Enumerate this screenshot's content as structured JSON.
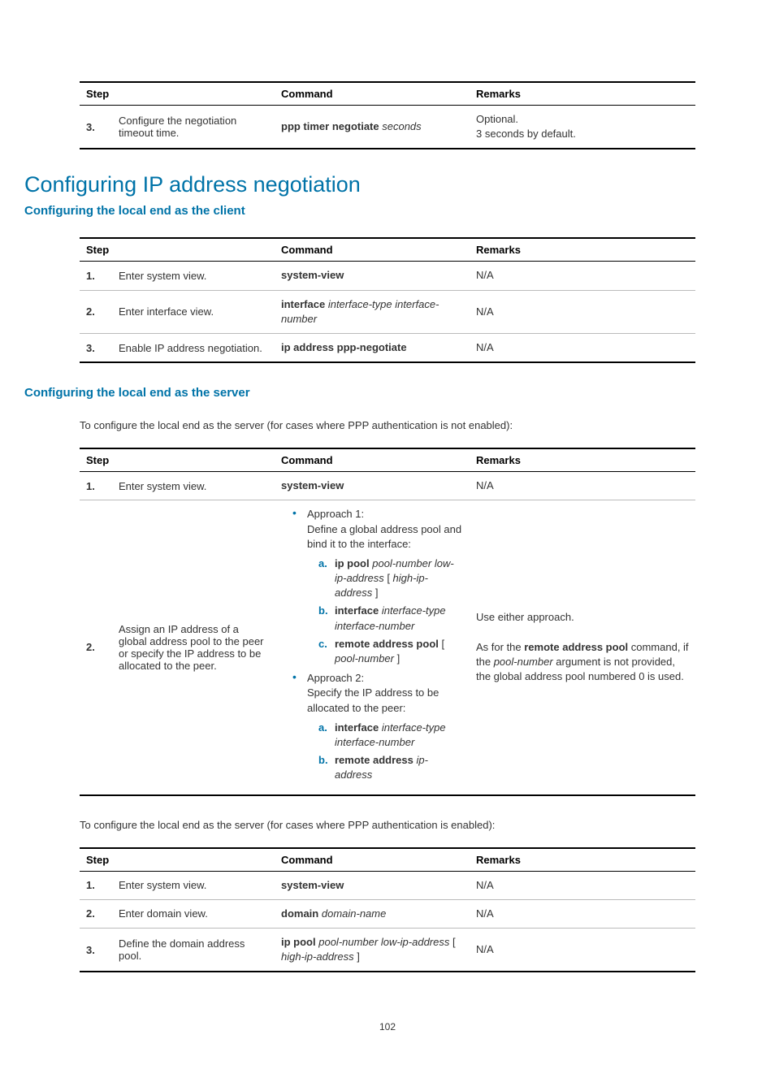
{
  "table1": {
    "headers": {
      "step": "Step",
      "command": "Command",
      "remarks": "Remarks"
    },
    "rows": [
      {
        "num": "3.",
        "step": "Configure the negotiation timeout time.",
        "cmd_bold": "ppp timer negotiate",
        "cmd_italic": " seconds",
        "remarks_line1": "Optional.",
        "remarks_line2": "3 seconds by default."
      }
    ]
  },
  "heading1": "Configuring IP address negotiation",
  "subheading1": "Configuring the local end as the client",
  "table2": {
    "headers": {
      "step": "Step",
      "command": "Command",
      "remarks": "Remarks"
    },
    "rows": [
      {
        "num": "1.",
        "step": "Enter system view.",
        "cmd_html": "<span class=\"bold\">system-view</span>",
        "remarks": "N/A"
      },
      {
        "num": "2.",
        "step": "Enter interface view.",
        "cmd_html": "<span class=\"bold\">interface</span> <span class=\"italic\">interface-type interface-number</span>",
        "remarks": "N/A"
      },
      {
        "num": "3.",
        "step": "Enable IP address negotiation.",
        "cmd_html": "<span class=\"bold\">ip address ppp-negotiate</span>",
        "remarks": "N/A"
      }
    ]
  },
  "subheading2": "Configuring the local end as the server",
  "para1": "To configure the local end as the server (for cases where PPP authentication is not enabled):",
  "table3": {
    "headers": {
      "step": "Step",
      "command": "Command",
      "remarks": "Remarks"
    },
    "row1": {
      "num": "1.",
      "step": "Enter system view.",
      "cmd_html": "<span class=\"bold\">system-view</span>",
      "remarks": "N/A"
    },
    "row2": {
      "num": "2.",
      "step": "Assign an IP address of a global address pool to the peer or specify the IP address to be allocated to the peer.",
      "approach1_label": "Approach 1:",
      "approach1_desc": "Define a global address pool and bind it to the interface:",
      "a1a": "<span class=\"bold\">ip pool</span> <span class=\"italic\">pool-number low-ip-address</span> [ <span class=\"italic\">high-ip-address</span> ]",
      "a1b": "<span class=\"bold\">interface</span> <span class=\"italic\">interface-type interface-number</span>",
      "a1c": "<span class=\"bold\">remote address pool</span> [ <span class=\"italic\">pool-number</span> ]",
      "approach2_label": "Approach 2:",
      "approach2_desc": "Specify the IP address to be allocated to the peer:",
      "a2a": "<span class=\"bold\">interface</span> <span class=\"italic\">interface-type interface-number</span>",
      "a2b": "<span class=\"bold\">remote address</span> <span class=\"italic\">ip-address</span>",
      "remarks_html": "Use either approach.<br><br>As for the <span class=\"bold\">remote address pool</span> command, if the <span class=\"italic\">pool-number</span> argument is not provided, the global address pool numbered 0 is used."
    }
  },
  "para2": "To configure the local end as the server (for cases where PPP authentication is enabled):",
  "table4": {
    "headers": {
      "step": "Step",
      "command": "Command",
      "remarks": "Remarks"
    },
    "rows": [
      {
        "num": "1.",
        "step": "Enter system view.",
        "cmd_html": "<span class=\"bold\">system-view</span>",
        "remarks": "N/A"
      },
      {
        "num": "2.",
        "step": "Enter domain view.",
        "cmd_html": "<span class=\"bold\">domain</span> <span class=\"italic\">domain-name</span>",
        "remarks": "N/A"
      },
      {
        "num": "3.",
        "step": "Define the domain address pool.",
        "cmd_html": "<span class=\"bold\">ip pool</span> <span class=\"italic\">pool-number low-ip-address</span> [ <span class=\"italic\">high-ip-address</span> ]",
        "remarks": "N/A"
      }
    ]
  },
  "letters": {
    "a": "a.",
    "b": "b.",
    "c": "c."
  },
  "page_number": "102"
}
